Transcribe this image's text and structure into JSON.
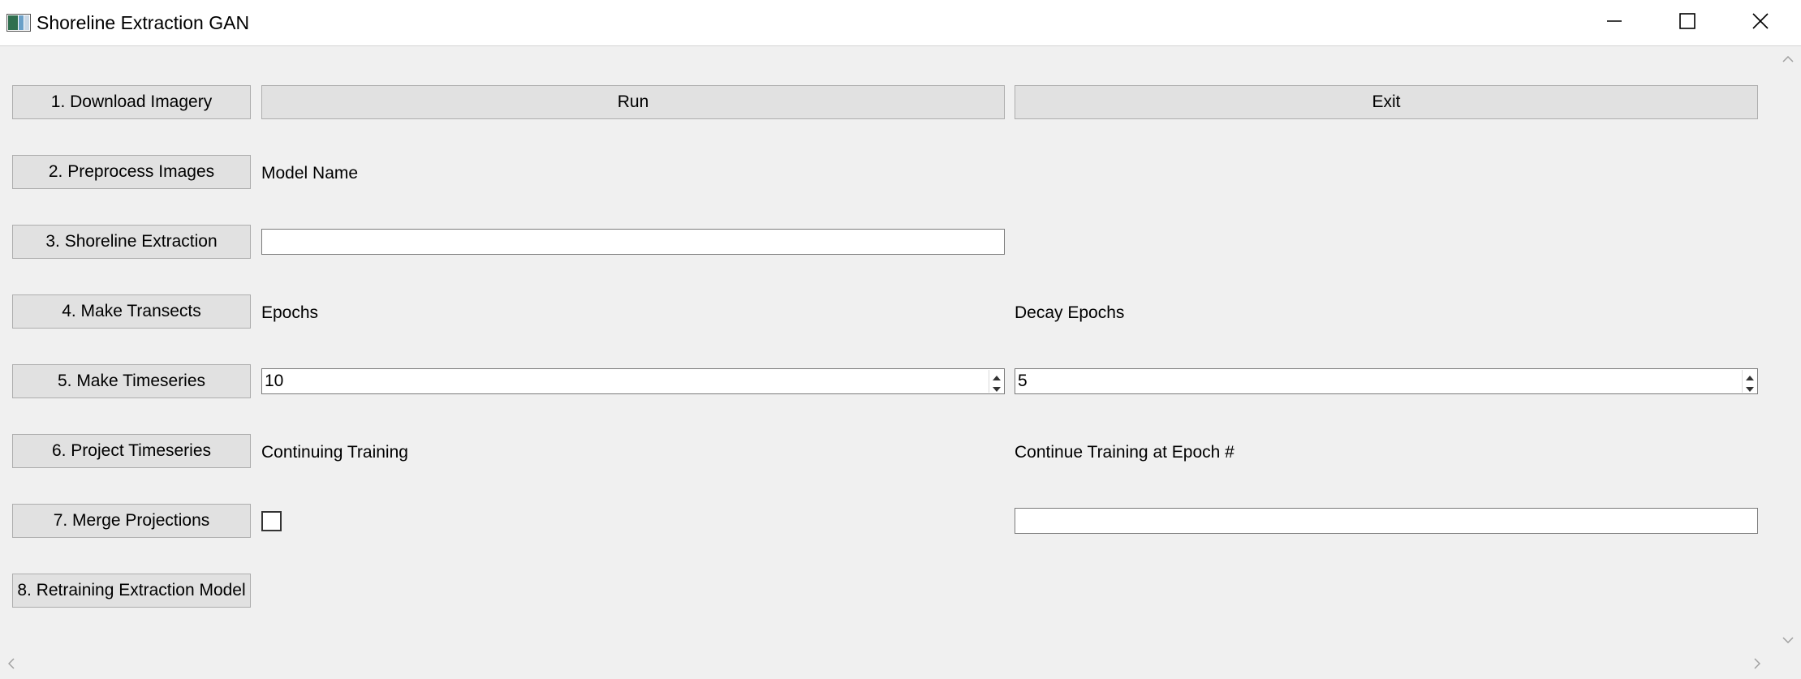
{
  "window": {
    "title": "Shoreline Extraction GAN",
    "icons": {
      "app": "app-window-icon",
      "minimize": "minimize-icon",
      "maximize": "maximize-icon",
      "close": "close-icon"
    }
  },
  "steps": [
    {
      "label": "1. Download Imagery"
    },
    {
      "label": "2. Preprocess Images"
    },
    {
      "label": "3. Shoreline Extraction"
    },
    {
      "label": "4. Make Transects"
    },
    {
      "label": "5. Make Timeseries"
    },
    {
      "label": "6. Project Timeseries"
    },
    {
      "label": "7. Merge Projections"
    },
    {
      "label": "8. Retraining Extraction Model"
    }
  ],
  "actions": {
    "run_label": "Run",
    "exit_label": "Exit"
  },
  "form": {
    "model_name_label": "Model Name",
    "model_name_value": "",
    "epochs_label": "Epochs",
    "epochs_value": "10",
    "decay_epochs_label": "Decay Epochs",
    "decay_epochs_value": "5",
    "continuing_training_label": "Continuing Training",
    "continuing_training_checked": false,
    "continue_epoch_label": "Continue Training at Epoch #",
    "continue_epoch_value": ""
  },
  "colors": {
    "window_bg": "#f0f0f0",
    "titlebar_bg": "#ffffff",
    "button_bg": "#e1e1e1",
    "button_border": "#adadad",
    "field_bg": "#ffffff",
    "field_border": "#7a7a7a"
  }
}
